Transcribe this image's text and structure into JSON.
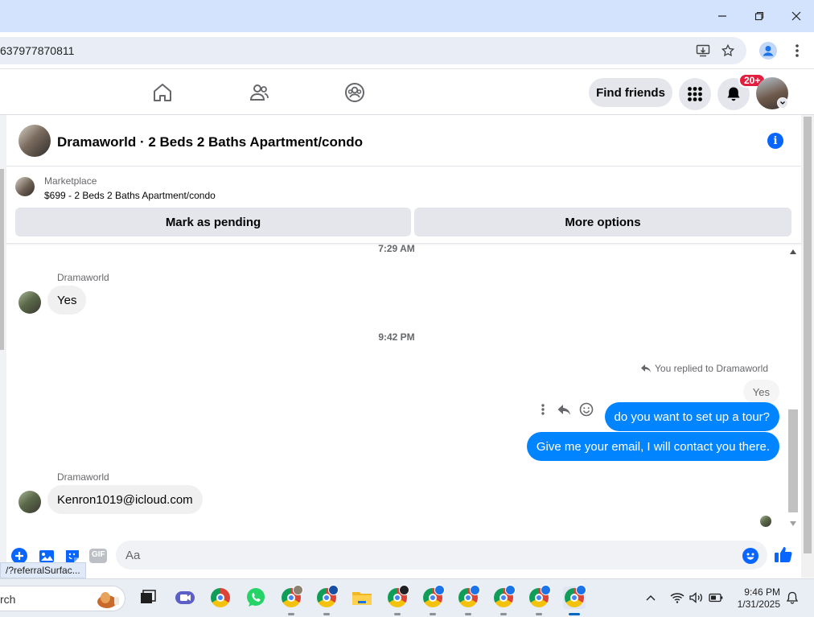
{
  "browser": {
    "url_fragment": "637977870811",
    "status_url": "/?referralSurfac..."
  },
  "fb_nav": {
    "find_friends_label": "Find friends",
    "notification_badge": "20+",
    "icons": [
      "home-icon",
      "friends-icon",
      "groups-icon",
      "menu-grid-icon",
      "bell-icon"
    ]
  },
  "chat": {
    "title": "Dramaworld · 2 Beds 2 Baths Apartment/condo",
    "marketplace": {
      "label": "Marketplace",
      "item": "$699 - 2 Beds 2 Baths Apartment/condo",
      "mark_pending_label": "Mark as pending",
      "more_options_label": "More options"
    },
    "messages": {
      "timestamp_top": "7:29 AM",
      "sender1": "Dramaworld",
      "msg1": "Yes",
      "timestamp_mid": "9:42 PM",
      "reply_note": "You replied to Dramaworld",
      "quoted_text": "Yes",
      "out1": "do you want to set up a tour?",
      "out2": "Give me your email, I will contact you there.",
      "sender2": "Dramaworld",
      "msg2": "Kenron1019@icloud.com"
    },
    "composer": {
      "placeholder": "Aa",
      "gif_label": "GIF"
    }
  },
  "taskbar": {
    "search_text": "rch",
    "time": "9:46 PM",
    "date": "1/31/2025"
  },
  "colors": {
    "messenger_blue": "#0084ff",
    "fb_blue": "#0866ff",
    "badge_red": "#e41e3f"
  }
}
